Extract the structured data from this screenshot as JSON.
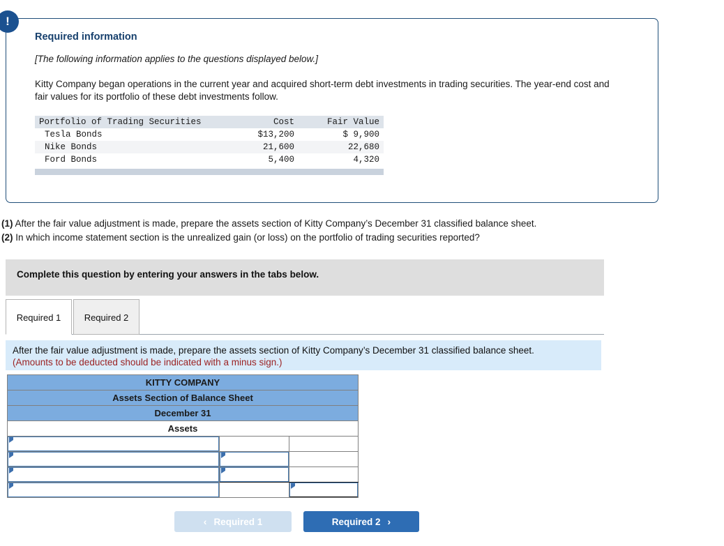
{
  "info_box": {
    "icon": "exclamation-icon",
    "heading": "Required information",
    "italic_note": "[The following information applies to the questions displayed below.]",
    "paragraph": "Kitty Company began operations in the current year and acquired short-term debt investments in trading securities. The year-end cost and fair values for its portfolio of these debt investments follow.",
    "table": {
      "headers": [
        "Portfolio of Trading Securities",
        "Cost",
        "Fair Value"
      ],
      "rows": [
        [
          "Tesla Bonds",
          "$13,200",
          "$ 9,900"
        ],
        [
          "Nike Bonds",
          "21,600",
          "22,680"
        ],
        [
          "Ford Bonds",
          "5,400",
          "4,320"
        ]
      ]
    }
  },
  "questions": [
    {
      "num": "(1)",
      "text": "After the fair value adjustment is made, prepare the assets section of Kitty Company’s December 31 classified balance sheet."
    },
    {
      "num": "(2)",
      "text": "In which income statement section is the unrealized gain (or loss) on the portfolio of trading securities reported?"
    }
  ],
  "gray_banner": {
    "text": "Complete this question by entering your answers in the tabs below."
  },
  "tabs": [
    {
      "label": "Required 1",
      "active": true
    },
    {
      "label": "Required 2",
      "active": false
    }
  ],
  "blue_panel": {
    "line1": "After the fair value adjustment is made, prepare the assets section of Kitty Company’s December 31 classified balance sheet.",
    "line2": "(Amounts to be deducted should be indicated with a minus sign.)"
  },
  "answer_table": {
    "title_rows": [
      "KITTY COMPANY",
      "Assets Section of Balance Sheet",
      "December 31"
    ],
    "section_header": "Assets",
    "input_rows": [
      {
        "label": "",
        "mid": "",
        "right": ""
      },
      {
        "label": "",
        "mid": "",
        "right": ""
      },
      {
        "label": "",
        "mid": "",
        "right": ""
      },
      {
        "label": "",
        "mid": "",
        "right": ""
      }
    ]
  },
  "nav": {
    "prev_label": "Required 1",
    "next_label": "Required 2",
    "prev_chevron": "‹",
    "next_chevron": "›"
  },
  "colors": {
    "box_border": "#1f4e79",
    "icon_bg": "#1b5190",
    "heading": "#17406d",
    "table_header_bg": "#7cacdf",
    "panel_bg": "#d8ebfa",
    "warning_text": "#9b2222",
    "next_button": "#2e6db4",
    "prev_button": "#cfe0f0"
  }
}
